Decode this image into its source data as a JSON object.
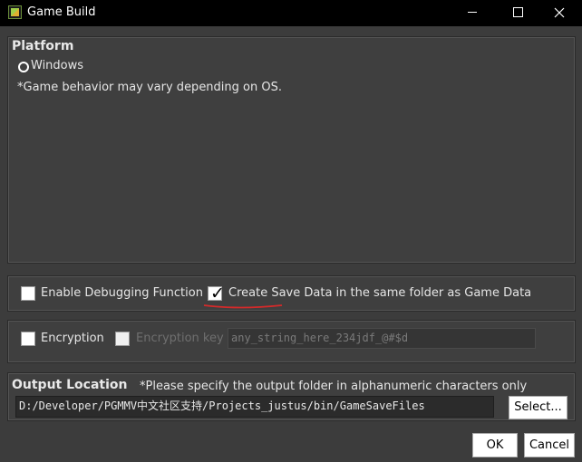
{
  "window": {
    "title": "Game Build",
    "icon": "game-app-icon",
    "controls": {
      "minimize": "minimize-icon",
      "maximize": "maximize-icon",
      "close": "close-icon"
    }
  },
  "platform": {
    "heading": "Platform",
    "option_label": "Windows",
    "option_selected": true,
    "note": "*Game behavior may vary depending on OS."
  },
  "debug": {
    "enable_debug_label": "Enable Debugging Function",
    "enable_debug_checked": false,
    "save_data_label": "Create Save Data in the same folder as Game Data",
    "save_data_checked": true,
    "check_glyph": "✓"
  },
  "encryption": {
    "encryption_label": "Encryption",
    "encryption_checked": false,
    "key_label": "Encryption key",
    "key_value": "any_string_here_234jdf_@#$d"
  },
  "output": {
    "heading": "Output Location",
    "note": "*Please specify the output folder in alphanumeric characters only",
    "path": "D:/Developer/PGMMV中文社区支持/Projects_justus/bin/GameSaveFiles",
    "select_label": "Select..."
  },
  "footer": {
    "ok_label": "OK",
    "cancel_label": "Cancel"
  },
  "colors": {
    "background": "#3c3c3c",
    "titlebar": "#000000",
    "annotation_underline": "#d42a2a"
  }
}
